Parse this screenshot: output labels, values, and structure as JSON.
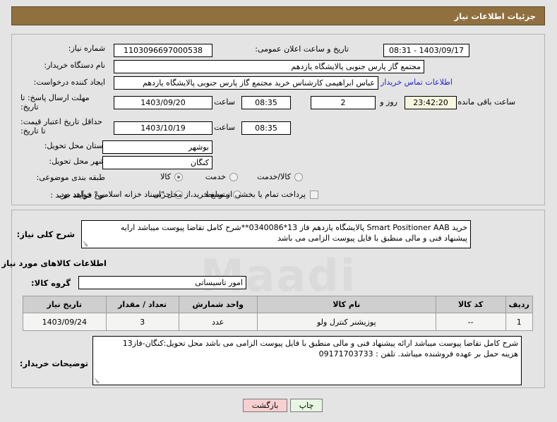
{
  "header": {
    "title": "جزئیات اطلاعات نیاز"
  },
  "form": {
    "need_number_label": "شماره نیاز:",
    "need_number_value": "1103096697000538",
    "announce_datetime_label": "تاریخ و ساعت اعلان عمومی:",
    "announce_datetime_value": "1403/09/17 - 08:31",
    "buyer_org_label": "نام دستگاه خریدار:",
    "buyer_org_value": "مجتمع گاز پارس جنوبی  پالایشگاه یازدهم",
    "requester_label": "ایجاد کننده درخواست:",
    "requester_value": "عباس ابراهیمی کارشناس خرید مجتمع گاز پارس جنوبی  پالایشگاه یازدهم",
    "buyer_contact_link": "اطلاعات تماس خریدار",
    "deadline_label": "مهلت ارسال پاسخ: تا تاریخ:",
    "deadline_date": "1403/09/20",
    "deadline_time_label": "ساعت",
    "deadline_time": "08:35",
    "remaining_days": "2",
    "remaining_days_label": "روز و",
    "remaining_time": "23:42:20",
    "remaining_time_label": "ساعت باقی مانده",
    "price_validity_label": "حداقل تاریخ اعتبار قیمت: تا تاریخ:",
    "price_validity_date": "1403/10/19",
    "price_validity_time_label": "ساعت",
    "price_validity_time": "08:35",
    "province_label": "استان محل تحویل:",
    "province_value": "بوشهر",
    "city_label": "شهر محل تحویل:",
    "city_value": "کنگان",
    "classification_label": "طبقه بندی موضوعی:",
    "classification_options": [
      {
        "label": "کالا",
        "selected": true
      },
      {
        "label": "خدمت",
        "selected": false
      },
      {
        "label": "کالا/خدمت",
        "selected": false
      }
    ],
    "process_type_label": "نوع فرآیند خرید :",
    "process_type_options": [
      {
        "label": "جزیی",
        "selected": false
      },
      {
        "label": "متوسط",
        "selected": false
      }
    ],
    "treasury_checkbox_label": "پرداخت تمام یا بخشی از مبلغ خرید،از محل \"اسناد خزانه اسلامی\" خواهد بود.",
    "treasury_checkbox_checked": false
  },
  "summary": {
    "label": "شرح کلی نیاز:",
    "line1": "خرید Smart Positioner AAB پالایشگاه یازدهم فاز 13*0340086**شرح کامل تقاضا پیوست میباشد ارایه",
    "line2": "پیشنهاد فنی و مالی منطبق با فایل پیوست الزامی می باشد"
  },
  "goods_section": {
    "caption": "اطلاعات کالاهای مورد نیاز",
    "group_label": "گروه کالا:",
    "group_value": "امور تاسیساتی",
    "columns": [
      "ردیف",
      "کد کالا",
      "نام کالا",
      "واحد شمارش",
      "تعداد / مقدار",
      "تاریخ نیاز"
    ],
    "rows": [
      {
        "radif": "1",
        "code": "--",
        "name": "پوزیشنر کنترل ولو",
        "unit": "عدد",
        "qty": "3",
        "date": "1403/09/24"
      }
    ]
  },
  "buyer_notes": {
    "label": "توضیحات خریدار:",
    "line1": "شرح کامل تقاضا پیوست میباشد ارائه پیشنهاد فنی و مالی منطبق با فایل پیوست الزامی می باشد محل تحویل:کنگان-فاز13",
    "line2": "هزینه حمل بر عهده فروشنده میباشد. تلفن : 09171703733"
  },
  "buttons": {
    "back": "بازگشت",
    "print": "چاپ"
  },
  "watermark": {
    "text": "Maadi"
  }
}
